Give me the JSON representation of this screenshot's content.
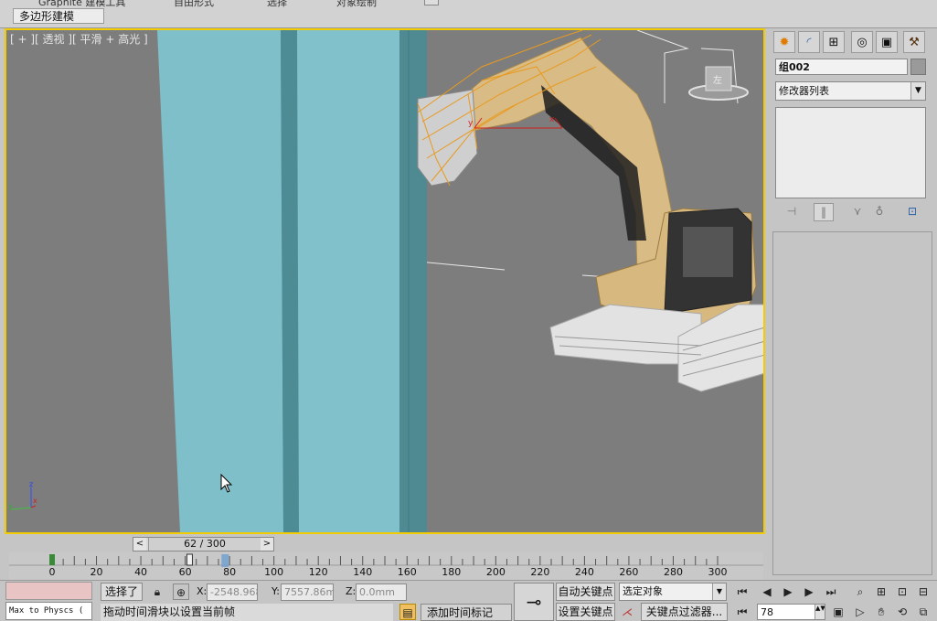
{
  "ribbon": {
    "tabs": [
      "Graphite 建模工具",
      "自由形式",
      "选择",
      "对象绘制"
    ],
    "sub_tab": "多边形建模"
  },
  "viewport": {
    "label": "[ + ] [ 透视 ] [ 平滑 + 高光 ]",
    "label_display": "[ + ][ 透视 ][ 平滑 + 高光 ]",
    "axis_z": "z",
    "axis_x": "x",
    "axis_y": "y",
    "gizmo_y": "y",
    "gizmo_x": "x",
    "viewcube_face": "左",
    "colors": {
      "border": "#f2cc00",
      "background": "#7d7d7d",
      "column": "#7fbfc9"
    }
  },
  "command_panel": {
    "tab_icons": [
      "create-icon",
      "modify-icon",
      "hierarchy-icon",
      "motion-icon",
      "display-icon",
      "utilities-icon"
    ],
    "object_name": "组002",
    "modifier_list": "修改器列表"
  },
  "time_slider": {
    "label": "62 / 300",
    "prev": "<",
    "next": ">",
    "current_frame": 62,
    "total_frames": 300
  },
  "track": {
    "ticks": [
      "0",
      "20",
      "40",
      "60",
      "80",
      "100",
      "120",
      "140",
      "160",
      "180",
      "200",
      "220",
      "240",
      "260",
      "280",
      "300"
    ]
  },
  "status": {
    "selection_label": "选择了",
    "x_label": "X:",
    "x_value": "-2548.968",
    "y_label": "Y:",
    "y_value": "7557.86mm",
    "z_label": "Z:",
    "z_value": "0.0mm",
    "script_listener": "Max to Physcs (",
    "prompt": "拖动时间滑块以设置当前帧",
    "add_time_tag": "添加时间标记",
    "auto_key": "自动关键点",
    "set_key": "设置关键点",
    "selected_object": "选定对象",
    "key_filters": "关键点过滤器...",
    "frame_value": "78"
  }
}
